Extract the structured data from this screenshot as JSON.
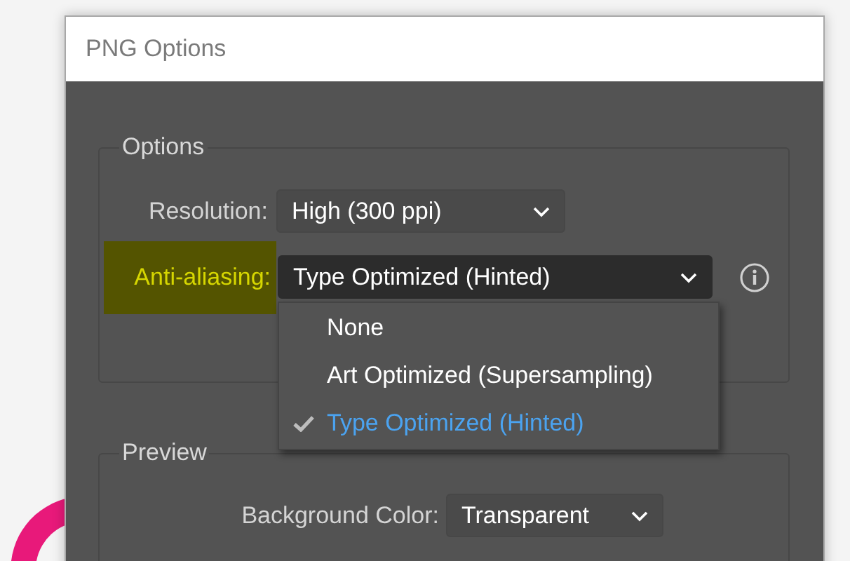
{
  "window": {
    "title": "PNG Options"
  },
  "options_group": {
    "title": "Options",
    "resolution": {
      "label": "Resolution:",
      "value": "High (300 ppi)"
    },
    "anti_aliasing": {
      "label": "Anti-aliasing:",
      "value": "Type Optimized (Hinted)",
      "highlighted": true,
      "expanded": true,
      "options": [
        {
          "label": "None",
          "selected": false
        },
        {
          "label": "Art Optimized (Supersampling)",
          "selected": false
        },
        {
          "label": "Type Optimized (Hinted)",
          "selected": true
        }
      ]
    }
  },
  "preview_group": {
    "title": "Preview",
    "background_color": {
      "label": "Background Color:",
      "value": "Transparent"
    }
  }
}
